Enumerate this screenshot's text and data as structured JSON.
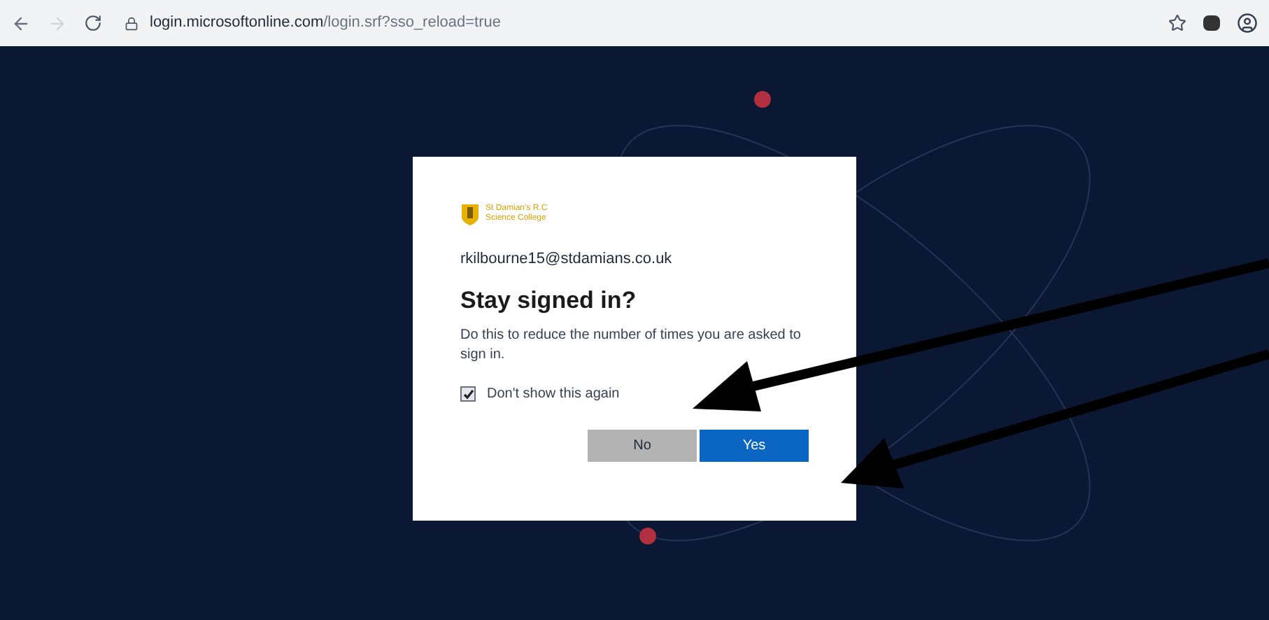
{
  "browser": {
    "url_host": "login.microsoftonline.com",
    "url_path": "/login.srf?sso_reload=true"
  },
  "dialog": {
    "logo_line_1": "St Damian's R.C",
    "logo_line_2": "Science College",
    "account": "rkilbourne15@stdamians.co.uk",
    "title": "Stay signed in?",
    "message": "Do this to reduce the number of times you are asked to sign in.",
    "checkbox": {
      "label": "Don't show this again",
      "checked": true
    },
    "buttons": [
      {
        "label": "No",
        "kind": "secondary"
      },
      {
        "label": "Yes",
        "kind": "primary"
      }
    ]
  }
}
